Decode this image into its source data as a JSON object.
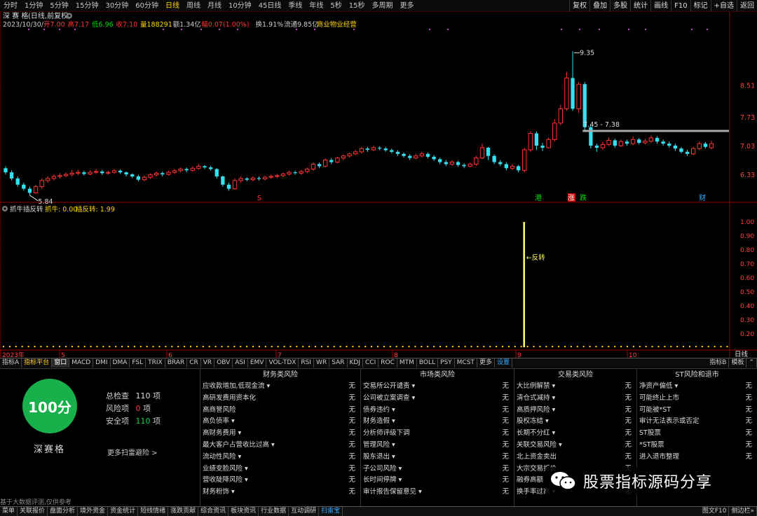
{
  "top_bar": {
    "periods": [
      "分时",
      "1分钟",
      "5分钟",
      "15分钟",
      "30分钟",
      "60分钟",
      "日线",
      "周线",
      "月线",
      "10分钟",
      "45日线",
      "季线",
      "年线",
      "5秒",
      "15秒",
      "多周期",
      "更多"
    ],
    "active_period": "日线",
    "right_buttons": [
      "复权",
      "叠加",
      "多股",
      "统计",
      "画线",
      "F10",
      "标记",
      "+自选",
      "返回"
    ]
  },
  "header": {
    "stock_name": "深 赛 格",
    "subtitle": "(日线,前复权)",
    "date": "2023/10/30/一",
    "quote": [
      {
        "label": "开",
        "value": "7.00",
        "color": "#ff3333"
      },
      {
        "label": "高",
        "value": "7.17",
        "color": "#ff3333"
      },
      {
        "label": "低",
        "value": "6.96",
        "color": "#00d800"
      },
      {
        "label": "收",
        "value": "7.10",
        "color": "#ff3333"
      },
      {
        "label": "量",
        "value": "188291",
        "color": "#ffd700"
      },
      {
        "label": "额",
        "value": "1.34亿",
        "color": "#cccccc"
      },
      {
        "label": "幅",
        "value": "0.07(1.00%)",
        "color": "#ff3333"
      },
      {
        "label": "换",
        "value": "1.91%",
        "color": "#cccccc"
      },
      {
        "label": "流通",
        "value": "9.85亿",
        "color": "#cccccc"
      }
    ],
    "sector": "商业物业经营"
  },
  "price_axis": [
    "8.51",
    "7.73",
    "7.03",
    "6.33"
  ],
  "annotations": {
    "high_label": "9.35",
    "low_label": "5.84",
    "range_label": "7.45 - 7.38",
    "event_markers": [
      {
        "text": "S",
        "color": "#ff3333"
      },
      {
        "text": "港",
        "color": "#00e000"
      },
      {
        "text": "涨",
        "color": "#ffffff",
        "bg": "#cc0000"
      },
      {
        "text": "跌",
        "color": "#00e000"
      },
      {
        "text": "财",
        "color": "#33aaff"
      }
    ]
  },
  "indicator": {
    "name": "抓牛插反转",
    "params": [
      {
        "label": "抓牛: 0.00",
        "color": "#ffd700"
      },
      {
        "label": "插反转: 1.99",
        "color": "#ffd700"
      }
    ],
    "axis": [
      "1.00",
      "0.90",
      "0.80",
      "0.70",
      "0.60",
      "0.50",
      "0.40",
      "0.30",
      "0.20"
    ],
    "signal_label": "←反转"
  },
  "time_axis": {
    "labels": [
      "2023年",
      "5",
      "6",
      "7",
      "8",
      "9",
      "10"
    ],
    "period": "日线"
  },
  "indicator_tabs": {
    "left": [
      "指标A",
      "指标平台",
      "窗口",
      "MACD",
      "DMI",
      "DMA",
      "FSL",
      "TRIX",
      "BRAR",
      "CR",
      "VR",
      "OBV",
      "ASI",
      "EMV",
      "VOL-TDX",
      "RSI",
      "WR",
      "SAR",
      "KDJ",
      "CCI",
      "ROC",
      "MTM",
      "BOLL",
      "PSY",
      "MCST",
      "更多",
      "设置"
    ],
    "right": [
      "指标B",
      "模板"
    ]
  },
  "scan": {
    "score": "100分",
    "stock": "深赛格",
    "total_label": "总检查",
    "total_value": "110",
    "risk_label": "风险项",
    "risk_value": "0",
    "safe_label": "安全项",
    "safe_value": "110",
    "unit": "项",
    "more": "更多扫雷避险 >",
    "disclaimer": "基于大数据评测,仅供参考",
    "columns": [
      {
        "title": "财务类风险",
        "items": [
          {
            "n": "应收款增加,低现金流 ▾",
            "v": "无"
          },
          {
            "n": "高研发费用资本化",
            "v": "无"
          },
          {
            "n": "高商誉风险",
            "v": "无"
          },
          {
            "n": "高负债率 ▾",
            "v": "无"
          },
          {
            "n": "高财务费用 ▾",
            "v": "无"
          },
          {
            "n": "最大客户占营收比过高 ▾",
            "v": "无"
          },
          {
            "n": "流动性风险 ▾",
            "v": "无"
          },
          {
            "n": "业绩变脸风险 ▾",
            "v": "无"
          },
          {
            "n": "营收陡降风险 ▾",
            "v": "无"
          },
          {
            "n": "财务粉饰 ▾",
            "v": "无"
          }
        ]
      },
      {
        "title": "市场类风险",
        "items": [
          {
            "n": "交易所公开谴责 ▾",
            "v": "无"
          },
          {
            "n": "公司被立案调查 ▾",
            "v": "无"
          },
          {
            "n": "债券违约 ▾",
            "v": "无"
          },
          {
            "n": "财务造假 ▾",
            "v": "无"
          },
          {
            "n": "分析师评级下调",
            "v": "无"
          },
          {
            "n": "管理风险 ▾",
            "v": "无"
          },
          {
            "n": "股东退出 ▾",
            "v": "无"
          },
          {
            "n": "子公司风险 ▾",
            "v": "无"
          },
          {
            "n": "长时间停牌 ▾",
            "v": "无"
          },
          {
            "n": "审计报告保留意见 ▾",
            "v": "无"
          }
        ]
      },
      {
        "title": "交易类风险",
        "items": [
          {
            "n": "大比例解禁 ▾",
            "v": "无"
          },
          {
            "n": "清仓式减持 ▾",
            "v": "无"
          },
          {
            "n": "高质押风险 ▾",
            "v": "无"
          },
          {
            "n": "股权冻结 ▾",
            "v": "无"
          },
          {
            "n": "长期不分红 ▾",
            "v": "无"
          },
          {
            "n": "关联交易风险 ▾",
            "v": "无"
          },
          {
            "n": "北上资金卖出",
            "v": "无"
          },
          {
            "n": "大宗交易折价",
            "v": "无"
          },
          {
            "n": "融券高额",
            "v": "无"
          },
          {
            "n": "换手率过高 ▾",
            "v": "无"
          }
        ]
      },
      {
        "title": "ST风险和退市",
        "items": [
          {
            "n": "净资产偏低 ▾",
            "v": "无"
          },
          {
            "n": "可能终止上市",
            "v": "无"
          },
          {
            "n": "可能被*ST",
            "v": "无"
          },
          {
            "n": "审计无法表示或否定",
            "v": "无"
          },
          {
            "n": "ST股票",
            "v": "无"
          },
          {
            "n": "*ST股票",
            "v": "无"
          },
          {
            "n": "进入退市整理",
            "v": "无"
          }
        ]
      }
    ]
  },
  "watermark": "股票指标源码分享",
  "func_bar": {
    "left": [
      "菜单",
      "关联报价",
      "盘面分析",
      "境外资金",
      "资金统计",
      "短线情绪",
      "涨跌贡献",
      "综合资讯",
      "板块资讯",
      "行业数据",
      "互动调研",
      "扫雷宝"
    ],
    "right": [
      "图文F10",
      "侧边栏»"
    ]
  },
  "colors": {
    "up": "#ff3333",
    "down": "#33e0f0",
    "accent": "#ffd700"
  },
  "chart_data": {
    "type": "candlestick",
    "ylim": [
      5.6,
      9.8
    ],
    "y_ticks": [
      8.51,
      7.73,
      7.03,
      6.33
    ],
    "candles": [
      [
        6.5,
        6.4,
        6.55,
        6.35
      ],
      [
        6.4,
        6.25,
        6.45,
        6.2
      ],
      [
        6.25,
        6.1,
        6.3,
        6.05
      ],
      [
        6.1,
        6.0,
        6.15,
        5.95
      ],
      [
        6.0,
        5.9,
        6.05,
        5.84
      ],
      [
        5.9,
        6.05,
        6.1,
        5.88
      ],
      [
        6.05,
        6.2,
        6.25,
        6.0
      ],
      [
        6.2,
        6.25,
        6.3,
        6.15
      ],
      [
        6.25,
        6.3,
        6.35,
        6.2
      ],
      [
        6.3,
        6.32,
        6.38,
        6.25
      ],
      [
        6.32,
        6.35,
        6.4,
        6.28
      ],
      [
        6.35,
        6.38,
        6.45,
        6.3
      ],
      [
        6.38,
        6.4,
        6.46,
        6.33
      ],
      [
        6.4,
        6.36,
        6.44,
        6.32
      ],
      [
        6.36,
        6.4,
        6.45,
        6.33
      ],
      [
        6.4,
        6.42,
        6.48,
        6.36
      ],
      [
        6.42,
        6.38,
        6.46,
        6.34
      ],
      [
        6.38,
        6.4,
        6.44,
        6.34
      ],
      [
        6.4,
        6.44,
        6.48,
        6.36
      ],
      [
        6.44,
        6.4,
        6.47,
        6.36
      ],
      [
        6.4,
        6.35,
        6.42,
        6.3
      ],
      [
        6.35,
        6.3,
        6.38,
        6.26
      ],
      [
        6.3,
        6.22,
        6.34,
        6.18
      ],
      [
        6.22,
        6.28,
        6.32,
        6.18
      ],
      [
        6.28,
        6.34,
        6.38,
        6.24
      ],
      [
        6.34,
        6.38,
        6.42,
        6.3
      ],
      [
        6.38,
        6.35,
        6.42,
        6.3
      ],
      [
        6.35,
        6.4,
        6.44,
        6.32
      ],
      [
        6.4,
        6.44,
        6.48,
        6.36
      ],
      [
        6.44,
        6.48,
        6.52,
        6.4
      ],
      [
        6.48,
        6.45,
        6.52,
        6.4
      ],
      [
        6.45,
        6.5,
        6.55,
        6.42
      ],
      [
        6.5,
        6.55,
        6.6,
        6.46
      ],
      [
        6.55,
        6.52,
        6.58,
        6.48
      ],
      [
        6.52,
        6.48,
        6.56,
        6.44
      ],
      [
        6.48,
        6.3,
        6.5,
        6.25
      ],
      [
        6.3,
        6.1,
        6.32,
        6.05
      ],
      [
        6.1,
        6.0,
        6.15,
        5.95
      ],
      [
        6.0,
        6.2,
        6.25,
        5.98
      ],
      [
        6.2,
        6.25,
        6.3,
        6.15
      ],
      [
        6.25,
        6.22,
        6.28,
        6.18
      ],
      [
        6.22,
        6.26,
        6.3,
        6.18
      ],
      [
        6.26,
        6.24,
        6.3,
        6.2
      ],
      [
        6.24,
        6.28,
        6.32,
        6.2
      ],
      [
        6.28,
        6.3,
        6.34,
        6.24
      ],
      [
        6.3,
        6.32,
        6.36,
        6.26
      ],
      [
        6.32,
        6.36,
        6.4,
        6.28
      ],
      [
        6.36,
        6.4,
        6.44,
        6.32
      ],
      [
        6.4,
        6.38,
        6.44,
        6.34
      ],
      [
        6.38,
        6.42,
        6.46,
        6.34
      ],
      [
        6.42,
        6.48,
        6.52,
        6.38
      ],
      [
        6.48,
        6.6,
        6.64,
        6.44
      ],
      [
        6.6,
        6.55,
        6.64,
        6.5
      ],
      [
        6.55,
        6.7,
        6.74,
        6.52
      ],
      [
        6.7,
        6.65,
        6.75,
        6.6
      ],
      [
        6.65,
        6.75,
        6.78,
        6.62
      ],
      [
        6.75,
        6.8,
        6.84,
        6.7
      ],
      [
        6.8,
        6.85,
        6.88,
        6.76
      ],
      [
        6.85,
        6.9,
        6.95,
        6.82
      ],
      [
        6.9,
        6.98,
        7.02,
        6.86
      ],
      [
        6.98,
        6.95,
        7.02,
        6.9
      ],
      [
        6.95,
        7.0,
        7.05,
        6.92
      ],
      [
        7.0,
        6.98,
        7.04,
        6.94
      ],
      [
        6.98,
        6.94,
        7.02,
        6.9
      ],
      [
        6.94,
        6.9,
        6.98,
        6.86
      ],
      [
        6.9,
        6.85,
        6.94,
        6.8
      ],
      [
        6.85,
        6.8,
        6.88,
        6.76
      ],
      [
        6.8,
        6.75,
        6.84,
        6.7
      ],
      [
        6.75,
        6.8,
        6.85,
        6.72
      ],
      [
        6.8,
        6.85,
        6.9,
        6.76
      ],
      [
        6.85,
        6.78,
        6.88,
        6.74
      ],
      [
        6.78,
        6.72,
        6.82,
        6.68
      ],
      [
        6.72,
        6.65,
        6.76,
        6.6
      ],
      [
        6.65,
        6.6,
        6.7,
        6.55
      ],
      [
        6.6,
        6.65,
        6.7,
        6.56
      ],
      [
        6.65,
        6.58,
        6.68,
        6.54
      ],
      [
        6.58,
        6.55,
        6.62,
        6.5
      ],
      [
        6.55,
        6.6,
        6.64,
        6.52
      ],
      [
        6.6,
        6.75,
        6.8,
        6.56
      ],
      [
        6.75,
        7.0,
        7.1,
        6.72
      ],
      [
        7.0,
        6.8,
        7.02,
        6.7
      ],
      [
        6.8,
        6.65,
        6.84,
        6.6
      ],
      [
        6.65,
        6.6,
        6.7,
        6.55
      ],
      [
        6.6,
        6.5,
        6.65,
        6.45
      ],
      [
        6.5,
        6.55,
        6.6,
        6.45
      ],
      [
        6.55,
        6.45,
        6.58,
        6.4
      ],
      [
        6.45,
        6.95,
        7.0,
        6.4
      ],
      [
        6.95,
        7.35,
        7.4,
        6.9
      ],
      [
        7.35,
        7.05,
        7.4,
        6.95
      ],
      [
        7.05,
        7.0,
        7.12,
        6.92
      ],
      [
        7.0,
        7.2,
        7.25,
        6.98
      ],
      [
        7.2,
        7.6,
        7.7,
        7.15
      ],
      [
        7.6,
        7.95,
        8.05,
        7.55
      ],
      [
        7.95,
        8.7,
        8.85,
        7.9
      ],
      [
        8.7,
        7.95,
        9.35,
        7.9
      ],
      [
        7.95,
        8.55,
        8.6,
        7.85
      ],
      [
        8.55,
        7.5,
        8.6,
        7.4
      ],
      [
        7.5,
        7.05,
        7.55,
        6.98
      ],
      [
        7.05,
        7.0,
        7.1,
        6.9
      ],
      [
        7.0,
        7.08,
        7.14,
        6.95
      ],
      [
        7.08,
        7.18,
        7.25,
        7.04
      ],
      [
        7.18,
        7.05,
        7.22,
        7.0
      ],
      [
        7.05,
        7.15,
        7.2,
        7.02
      ],
      [
        7.15,
        7.1,
        7.2,
        7.05
      ],
      [
        7.1,
        7.2,
        7.28,
        7.06
      ],
      [
        7.2,
        7.12,
        7.24,
        7.08
      ],
      [
        7.12,
        7.16,
        7.22,
        7.08
      ],
      [
        7.16,
        7.24,
        7.3,
        7.12
      ],
      [
        7.24,
        7.15,
        7.28,
        7.1
      ],
      [
        7.15,
        7.1,
        7.2,
        7.05
      ],
      [
        7.1,
        7.05,
        7.15,
        7.0
      ],
      [
        7.05,
        6.98,
        7.1,
        6.92
      ],
      [
        6.98,
        6.9,
        7.02,
        6.86
      ],
      [
        6.9,
        6.85,
        6.95,
        6.8
      ],
      [
        6.85,
        6.98,
        7.02,
        6.82
      ],
      [
        6.98,
        7.1,
        7.15,
        6.94
      ],
      [
        7.1,
        7.02,
        7.14,
        6.98
      ],
      [
        7.0,
        7.1,
        7.17,
        6.96
      ]
    ],
    "indicator_series": {
      "signal_index": 86,
      "signal_value": 1.0,
      "ylim": [
        0.1,
        1.05
      ]
    },
    "resistance": {
      "value": 7.41,
      "from_index": 96
    }
  }
}
